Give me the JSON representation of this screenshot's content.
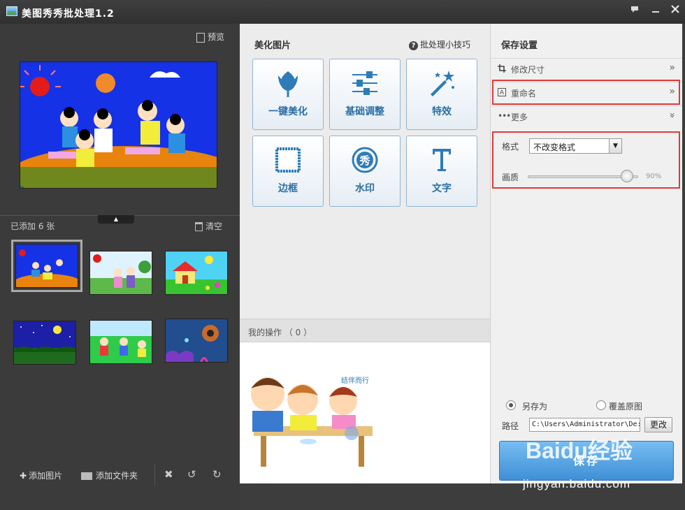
{
  "window": {
    "title": "美图秀秀批处理1.2",
    "controls": [
      "feedback-icon",
      "minimize-icon",
      "close-icon"
    ]
  },
  "left": {
    "preview_label": "预览",
    "added_count": "已添加 6 张",
    "clear_label": "清空",
    "thumbnails": [
      {
        "name": "basketball",
        "selected": true
      },
      {
        "name": "farm-kids",
        "selected": false
      },
      {
        "name": "house-garden",
        "selected": false
      },
      {
        "name": "night-sky",
        "selected": false
      },
      {
        "name": "playground",
        "selected": false
      },
      {
        "name": "underwater",
        "selected": false
      }
    ],
    "bottom": {
      "add_image": "添加图片",
      "add_folder": "添加文件夹"
    }
  },
  "center": {
    "title": "美化图片",
    "tips": "批处理小技巧",
    "tools": [
      {
        "label": "一键美化",
        "icon": "tulip-icon"
      },
      {
        "label": "基础调整",
        "icon": "sliders-icon"
      },
      {
        "label": "特效",
        "icon": "magic-wand-icon"
      },
      {
        "label": "边框",
        "icon": "frame-icon"
      },
      {
        "label": "水印",
        "icon": "watermark-icon"
      },
      {
        "label": "文字",
        "icon": "text-icon"
      }
    ],
    "ops_title": "我的操作 （ 0 ）",
    "cartoon_caption": "结伴而行"
  },
  "right": {
    "title": "保存设置",
    "rows": [
      {
        "label": "修改尺寸",
        "icon": "crop-icon"
      },
      {
        "label": "重命名",
        "icon": "rename-icon"
      },
      {
        "label": "更多",
        "icon": "more-icon"
      }
    ],
    "format_label": "格式",
    "format_value": "不改变格式",
    "quality_label": "画质",
    "quality_value": 90,
    "quality_text": "90%",
    "save_as": "另存为",
    "overwrite": "覆盖原图",
    "path_label": "路径",
    "path_value": "C:\\Users\\Administrator\\De:",
    "change_label": "更改",
    "save_label": "保存"
  },
  "watermark": {
    "brand": "Baidu经验",
    "url": "jingyan.baidu.com"
  },
  "colors": {
    "accent": "#2d7cb8",
    "highlight": "#e03a3a",
    "save": "#4a98dc"
  }
}
